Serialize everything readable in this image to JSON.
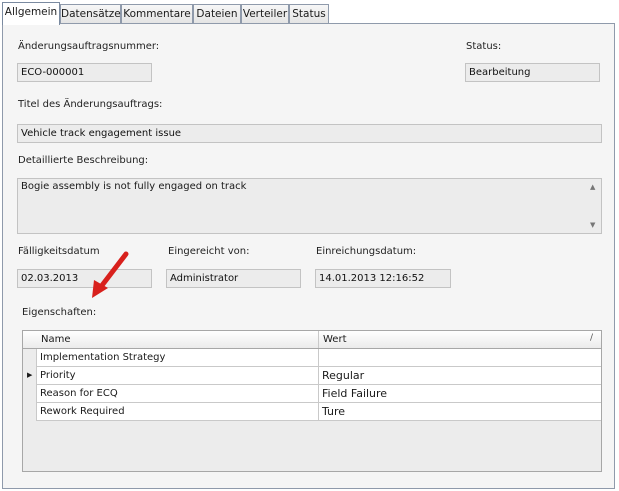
{
  "tabs": [
    "Allgemein",
    "Datensätze",
    "Kommentare",
    "Dateien",
    "Verteiler",
    "Status"
  ],
  "labels": {
    "change_order_number": "Änderungsauftragsnummer:",
    "status": "Status:",
    "title": "Titel des Änderungsauftrags:",
    "description": "Detaillierte Beschreibung:",
    "due_date": "Fälligkeitsdatum",
    "submitted_by": "Eingereicht von:",
    "submission_date": "Einreichungsdatum:",
    "properties": "Eigenschaften:"
  },
  "values": {
    "change_order_number": "ECO-000001",
    "status": "Bearbeitung",
    "title": "Vehicle track engagement issue",
    "description": "Bogie assembly is not fully engaged on track",
    "due_date": "02.03.2013",
    "submitted_by": "Administrator",
    "submission_date": "14.01.2013 12:16:52"
  },
  "grid": {
    "columns": [
      "Name",
      "Wert"
    ],
    "rows": [
      {
        "name": "Implementation Strategy",
        "value": ""
      },
      {
        "name": "Priority",
        "value": "Regular"
      },
      {
        "name": "Reason for ECQ",
        "value": "Field Failure"
      },
      {
        "name": "Rework Required",
        "value": "Ture"
      }
    ]
  },
  "colors": {
    "arrow": "#d8201c",
    "border": "#8f9aab"
  }
}
